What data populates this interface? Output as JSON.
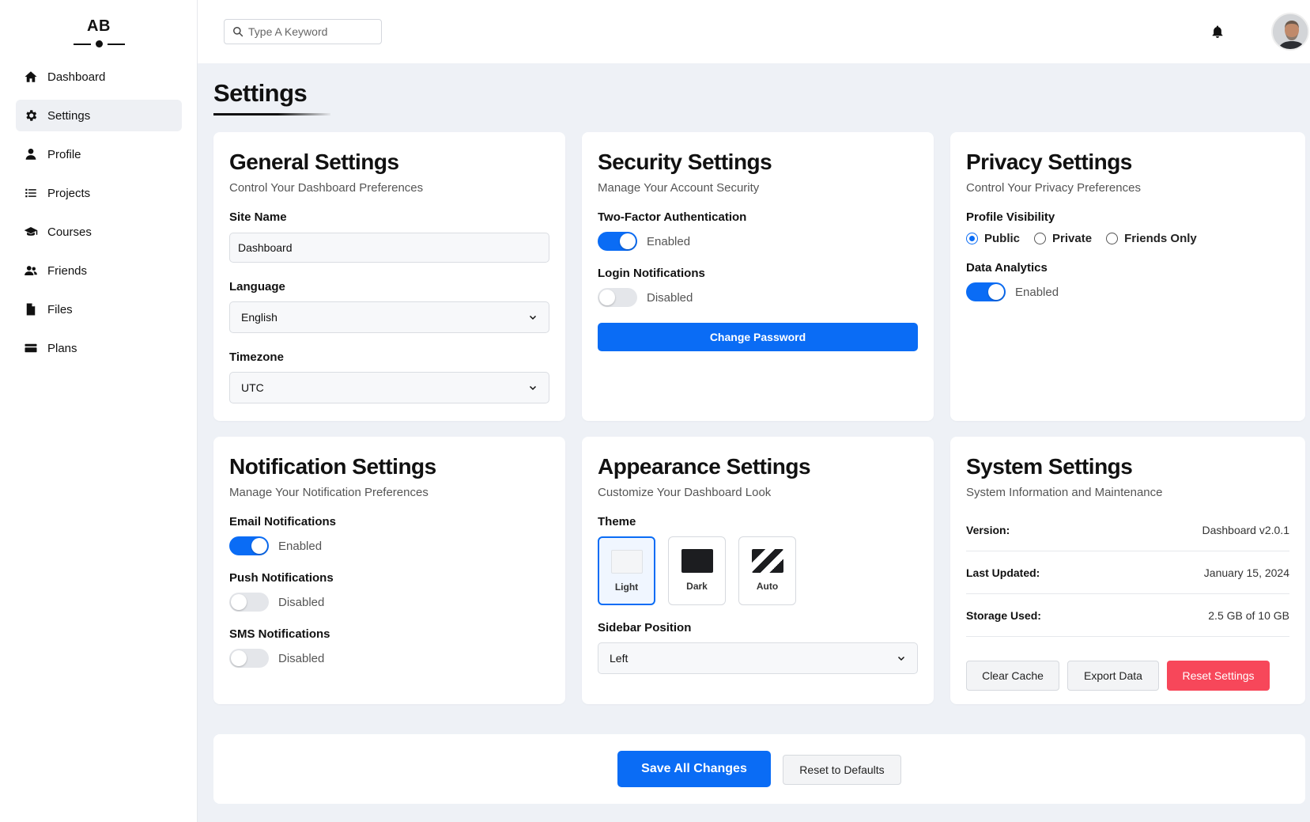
{
  "app": {
    "logo_text": "AB"
  },
  "sidebar": {
    "items": [
      {
        "label": "Dashboard",
        "icon": "home-icon"
      },
      {
        "label": "Settings",
        "icon": "gear-icon",
        "active": true
      },
      {
        "label": "Profile",
        "icon": "user-icon"
      },
      {
        "label": "Projects",
        "icon": "list-icon"
      },
      {
        "label": "Courses",
        "icon": "graduation-cap-icon"
      },
      {
        "label": "Friends",
        "icon": "users-icon"
      },
      {
        "label": "Files",
        "icon": "file-icon"
      },
      {
        "label": "Plans",
        "icon": "credit-card-icon"
      }
    ]
  },
  "header": {
    "search_placeholder": "Type A Keyword",
    "icons": [
      "search-icon",
      "bell-icon",
      "avatar"
    ]
  },
  "page": {
    "title": "Settings"
  },
  "general": {
    "title": "General Settings",
    "subtitle": "Control Your Dashboard Preferences",
    "site_name_label": "Site Name",
    "site_name_value": "Dashboard",
    "language_label": "Language",
    "language_value": "English",
    "timezone_label": "Timezone",
    "timezone_value": "UTC"
  },
  "security": {
    "title": "Security Settings",
    "subtitle": "Manage Your Account Security",
    "two_factor_label": "Two-Factor Authentication",
    "two_factor_state": "Enabled",
    "login_notif_label": "Login Notifications",
    "login_notif_state": "Disabled",
    "change_password_label": "Change Password"
  },
  "privacy": {
    "title": "Privacy Settings",
    "subtitle": "Control Your Privacy Preferences",
    "visibility_label": "Profile Visibility",
    "visibility_options": [
      "Public",
      "Private",
      "Friends Only"
    ],
    "visibility_selected": "Public",
    "analytics_label": "Data Analytics",
    "analytics_state": "Enabled"
  },
  "notifications": {
    "title": "Notification Settings",
    "subtitle": "Manage Your Notification Preferences",
    "email_label": "Email Notifications",
    "email_state": "Enabled",
    "push_label": "Push Notifications",
    "push_state": "Disabled",
    "sms_label": "SMS Notifications",
    "sms_state": "Disabled"
  },
  "appearance": {
    "title": "Appearance Settings",
    "subtitle": "Customize Your Dashboard Look",
    "theme_label": "Theme",
    "themes": [
      "Light",
      "Dark",
      "Auto"
    ],
    "theme_selected": "Light",
    "sidebar_position_label": "Sidebar Position",
    "sidebar_position_value": "Left"
  },
  "system": {
    "title": "System Settings",
    "subtitle": "System Information and Maintenance",
    "version_label": "Version:",
    "version_value": "Dashboard v2.0.1",
    "updated_label": "Last Updated:",
    "updated_value": "January 15, 2024",
    "storage_label": "Storage Used:",
    "storage_value": "2.5 GB of 10 GB",
    "clear_cache_label": "Clear Cache",
    "export_label": "Export Data",
    "reset_label": "Reset Settings"
  },
  "footer": {
    "save_label": "Save All Changes",
    "reset_defaults_label": "Reset to Defaults"
  },
  "colors": {
    "accent": "#0a6cf5",
    "danger": "#f7475a",
    "background": "#eef1f6"
  }
}
